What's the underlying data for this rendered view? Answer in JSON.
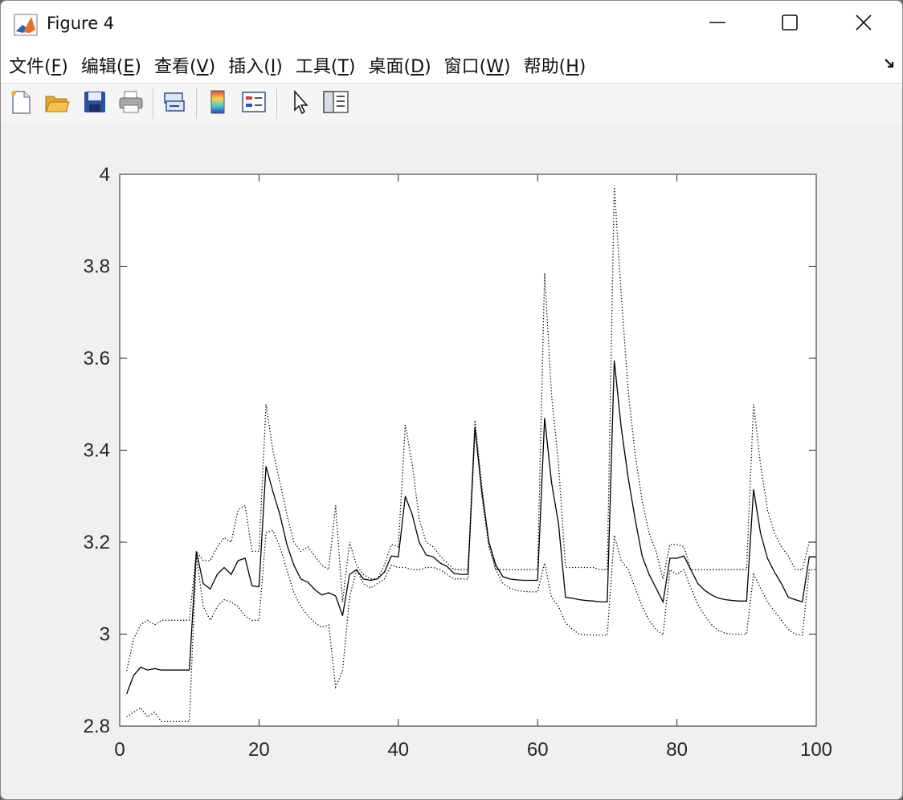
{
  "window": {
    "title": "Figure 4"
  },
  "menu": [
    {
      "pre": "文件(",
      "key": "F",
      "post": ")"
    },
    {
      "pre": "编辑(",
      "key": "E",
      "post": ")"
    },
    {
      "pre": "查看(",
      "key": "V",
      "post": ")"
    },
    {
      "pre": "插入(",
      "key": "I",
      "post": ")"
    },
    {
      "pre": "工具(",
      "key": "T",
      "post": ")"
    },
    {
      "pre": "桌面(",
      "key": "D",
      "post": ")"
    },
    {
      "pre": "窗口(",
      "key": "W",
      "post": ")"
    },
    {
      "pre": "帮助(",
      "key": "H",
      "post": ")"
    }
  ],
  "toolbar_icons": [
    "new-figure-icon",
    "open-file-icon",
    "save-icon",
    "print-icon",
    "link-plot-icon",
    "colorbar-icon",
    "legend-icon",
    "edit-plot-arrow-icon",
    "property-inspector-icon"
  ],
  "chart_data": {
    "type": "line",
    "title": "",
    "xlabel": "",
    "ylabel": "",
    "xlim": [
      0,
      100
    ],
    "ylim": [
      2.8,
      4.0
    ],
    "xticks": [
      0,
      20,
      40,
      60,
      80,
      100
    ],
    "yticks": [
      2.8,
      3.0,
      3.2,
      3.4,
      3.6,
      3.8,
      4.0
    ],
    "ytick_labels": [
      "2.8",
      "3",
      "3.2",
      "3.4",
      "3.6",
      "3.8",
      "4"
    ],
    "grid": false,
    "legend": false,
    "series": [
      {
        "style": "solid",
        "x": [
          1,
          2,
          3,
          4,
          5,
          6,
          7,
          8,
          9,
          10,
          11,
          12,
          13,
          14,
          15,
          16,
          17,
          18,
          19,
          20,
          21,
          22,
          23,
          24,
          25,
          26,
          27,
          28,
          29,
          30,
          31,
          32,
          33,
          34,
          35,
          36,
          37,
          38,
          39,
          40,
          41,
          42,
          43,
          44,
          45,
          46,
          47,
          48,
          49,
          50,
          51,
          52,
          53,
          54,
          55,
          56,
          57,
          58,
          59,
          60,
          61,
          62,
          63,
          64,
          65,
          66,
          67,
          68,
          69,
          70,
          71,
          72,
          73,
          74,
          75,
          76,
          77,
          78,
          79,
          80,
          81,
          82,
          83,
          84,
          85,
          86,
          87,
          88,
          89,
          90,
          91,
          92,
          93,
          94,
          95,
          96,
          97,
          98,
          99,
          100
        ],
        "y": [
          2.87,
          2.91,
          2.928,
          2.922,
          2.925,
          2.922,
          2.922,
          2.922,
          2.922,
          2.922,
          3.18,
          3.11,
          3.098,
          3.13,
          3.145,
          3.13,
          3.16,
          3.165,
          3.105,
          3.103,
          3.365,
          3.31,
          3.26,
          3.195,
          3.15,
          3.12,
          3.113,
          3.097,
          3.085,
          3.09,
          3.083,
          3.04,
          3.13,
          3.14,
          3.12,
          3.117,
          3.12,
          3.135,
          3.17,
          3.168,
          3.3,
          3.26,
          3.2,
          3.172,
          3.168,
          3.155,
          3.147,
          3.132,
          3.13,
          3.13,
          3.45,
          3.31,
          3.2,
          3.15,
          3.125,
          3.12,
          3.118,
          3.117,
          3.117,
          3.117,
          3.47,
          3.33,
          3.24,
          3.08,
          3.078,
          3.075,
          3.073,
          3.072,
          3.07,
          3.07,
          3.595,
          3.45,
          3.34,
          3.25,
          3.17,
          3.13,
          3.1,
          3.07,
          3.165,
          3.165,
          3.17,
          3.14,
          3.11,
          3.095,
          3.085,
          3.078,
          3.075,
          3.073,
          3.072,
          3.072,
          3.315,
          3.22,
          3.165,
          3.135,
          3.11,
          3.08,
          3.075,
          3.07,
          3.168,
          3.168
        ]
      },
      {
        "style": "dotted",
        "x": [
          1,
          2,
          3,
          4,
          5,
          6,
          7,
          8,
          9,
          10,
          11,
          12,
          13,
          14,
          15,
          16,
          17,
          18,
          19,
          20,
          21,
          22,
          23,
          24,
          25,
          26,
          27,
          28,
          29,
          30,
          31,
          32,
          33,
          34,
          35,
          36,
          37,
          38,
          39,
          40,
          41,
          42,
          43,
          44,
          45,
          46,
          47,
          48,
          49,
          50,
          51,
          52,
          53,
          54,
          55,
          56,
          57,
          58,
          59,
          60,
          61,
          62,
          63,
          64,
          65,
          66,
          67,
          68,
          69,
          70,
          71,
          72,
          73,
          74,
          75,
          76,
          77,
          78,
          79,
          80,
          81,
          82,
          83,
          84,
          85,
          86,
          87,
          88,
          89,
          90,
          91,
          92,
          93,
          94,
          95,
          96,
          97,
          98,
          99,
          100
        ],
        "y": [
          2.92,
          2.99,
          3.02,
          3.03,
          3.02,
          3.03,
          3.03,
          3.03,
          3.03,
          3.03,
          3.18,
          3.16,
          3.16,
          3.19,
          3.21,
          3.2,
          3.27,
          3.28,
          3.18,
          3.18,
          3.5,
          3.4,
          3.33,
          3.26,
          3.2,
          3.18,
          3.19,
          3.17,
          3.15,
          3.14,
          3.28,
          3.07,
          3.2,
          3.15,
          3.13,
          3.12,
          3.12,
          3.15,
          3.195,
          3.19,
          3.455,
          3.37,
          3.25,
          3.2,
          3.19,
          3.17,
          3.155,
          3.14,
          3.14,
          3.14,
          3.465,
          3.32,
          3.2,
          3.14,
          3.14,
          3.14,
          3.14,
          3.14,
          3.14,
          3.14,
          3.785,
          3.52,
          3.37,
          3.145,
          3.145,
          3.145,
          3.145,
          3.145,
          3.14,
          3.14,
          3.975,
          3.74,
          3.53,
          3.39,
          3.29,
          3.22,
          3.18,
          3.12,
          3.195,
          3.195,
          3.19,
          3.14,
          3.14,
          3.14,
          3.14,
          3.14,
          3.14,
          3.14,
          3.14,
          3.14,
          3.5,
          3.37,
          3.27,
          3.22,
          3.19,
          3.17,
          3.14,
          3.14,
          3.2,
          3.2
        ]
      },
      {
        "style": "dotted",
        "x": [
          1,
          2,
          3,
          4,
          5,
          6,
          7,
          8,
          9,
          10,
          11,
          12,
          13,
          14,
          15,
          16,
          17,
          18,
          19,
          20,
          21,
          22,
          23,
          24,
          25,
          26,
          27,
          28,
          29,
          30,
          31,
          32,
          33,
          34,
          35,
          36,
          37,
          38,
          39,
          40,
          41,
          42,
          43,
          44,
          45,
          46,
          47,
          48,
          49,
          50,
          51,
          52,
          53,
          54,
          55,
          56,
          57,
          58,
          59,
          60,
          61,
          62,
          63,
          64,
          65,
          66,
          67,
          68,
          69,
          70,
          71,
          72,
          73,
          74,
          75,
          76,
          77,
          78,
          79,
          80,
          81,
          82,
          83,
          84,
          85,
          86,
          87,
          88,
          89,
          90,
          91,
          92,
          93,
          94,
          95,
          96,
          97,
          98,
          99,
          100
        ],
        "y": [
          2.82,
          2.83,
          2.84,
          2.82,
          2.83,
          2.81,
          2.81,
          2.81,
          2.81,
          2.81,
          3.17,
          3.06,
          3.03,
          3.06,
          3.075,
          3.07,
          3.06,
          3.04,
          3.03,
          3.03,
          3.22,
          3.225,
          3.19,
          3.14,
          3.09,
          3.06,
          3.04,
          3.025,
          3.015,
          3.02,
          2.885,
          2.92,
          3.08,
          3.14,
          3.11,
          3.1,
          3.11,
          3.12,
          3.15,
          3.145,
          3.145,
          3.14,
          3.14,
          3.145,
          3.145,
          3.14,
          3.13,
          3.12,
          3.12,
          3.12,
          3.45,
          3.3,
          3.19,
          3.14,
          3.11,
          3.1,
          3.095,
          3.093,
          3.092,
          3.092,
          3.155,
          3.08,
          3.06,
          3.025,
          3.01,
          3.0,
          2.998,
          2.998,
          2.998,
          2.998,
          3.215,
          3.16,
          3.14,
          3.1,
          3.06,
          3.03,
          3.01,
          2.998,
          3.14,
          3.13,
          3.14,
          3.1,
          3.065,
          3.04,
          3.02,
          3.008,
          3.002,
          3.0,
          3.0,
          3.0,
          3.13,
          3.1,
          3.07,
          3.05,
          3.03,
          3.01,
          3.0,
          2.998,
          3.14,
          3.14
        ]
      }
    ]
  }
}
